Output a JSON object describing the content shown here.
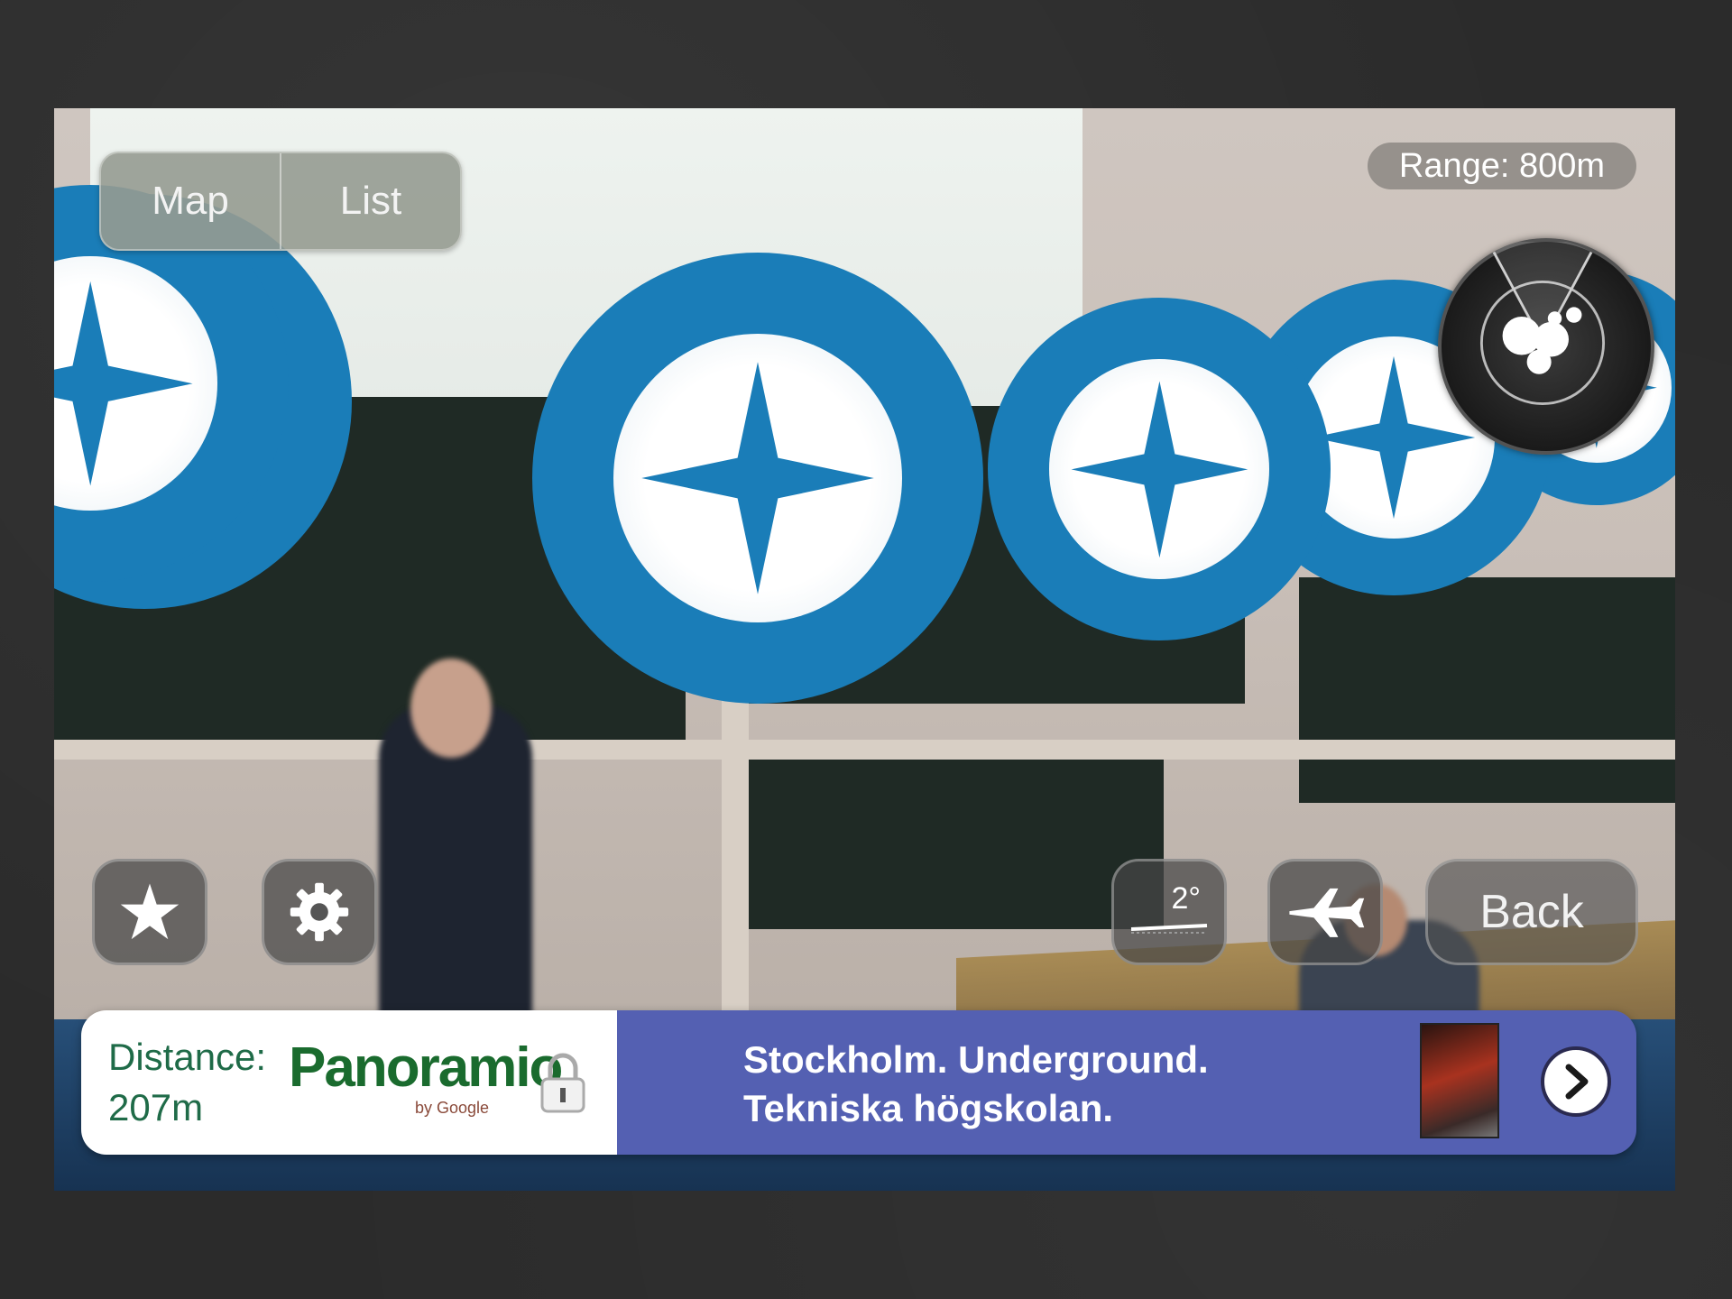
{
  "top_bar": {
    "map_label": "Map",
    "list_label": "List",
    "range_text": "Range: 800m"
  },
  "controls": {
    "back_label": "Back",
    "tilt_value": "2°"
  },
  "info_bar": {
    "distance_label": "Distance:",
    "distance_value": "207m",
    "source_logo_text": "Panoramio",
    "source_logo_sub": "by Google",
    "poi_title_line1": "Stockholm. Underground.",
    "poi_title_line2": "Tekniska högskolan."
  },
  "icons": {
    "favorites": "star-icon",
    "settings": "gear-icon",
    "tilt": "tilt-icon",
    "airplane": "airplane-icon",
    "radar": "radar-icon",
    "lock": "lock-icon",
    "details": "chevron-right-icon",
    "poi": "compass-star-icon"
  },
  "colors": {
    "marker_blue": "#1a7db8",
    "info_purple": "#5460b2",
    "distance_green": "#1f6b48"
  }
}
